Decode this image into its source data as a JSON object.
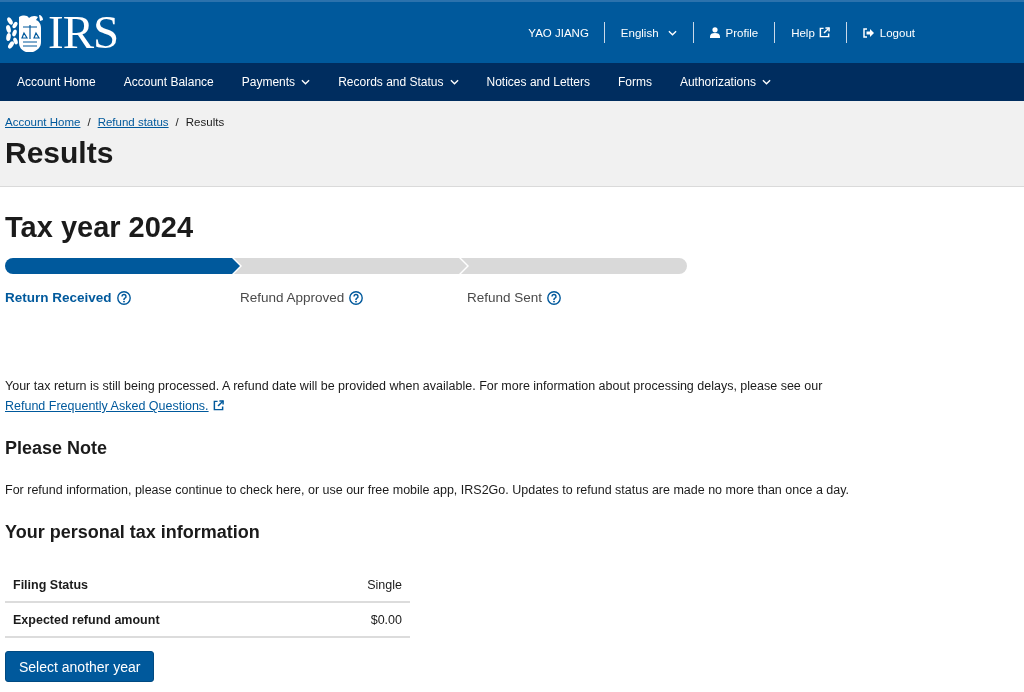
{
  "header": {
    "logo_text": "IRS",
    "user_name": "YAO JIANG",
    "links": [
      {
        "kind": "language",
        "label": "English"
      },
      {
        "kind": "profile",
        "label": "Profile"
      },
      {
        "kind": "help",
        "label": "Help"
      },
      {
        "kind": "logout",
        "label": "Logout"
      }
    ]
  },
  "nav": {
    "items": [
      {
        "label": "Account Home",
        "has_menu": false
      },
      {
        "label": "Account Balance",
        "has_menu": false
      },
      {
        "label": "Payments",
        "has_menu": true
      },
      {
        "label": "Records and Status",
        "has_menu": true
      },
      {
        "label": "Notices and Letters",
        "has_menu": false
      },
      {
        "label": "Forms",
        "has_menu": false
      },
      {
        "label": "Authorizations",
        "has_menu": true
      }
    ]
  },
  "breadcrumb": {
    "separator": "/",
    "items": [
      {
        "kind": "link",
        "label": "Account Home"
      },
      {
        "kind": "link",
        "label": "Refund status"
      },
      {
        "kind": "current",
        "label": "Results"
      }
    ]
  },
  "page_title": "Results",
  "tax_year_title": "Tax year 2024",
  "steps": [
    {
      "label": "Return Received",
      "completed": true
    },
    {
      "label": "Refund Approved",
      "completed": false
    },
    {
      "label": "Refund Sent",
      "completed": false
    }
  ],
  "message": {
    "text": "Your tax return is still being processed. A refund date will be provided when available. For more information about processing delays, please see our",
    "link": "Refund Frequently Asked Questions."
  },
  "note": {
    "heading": "Please Note",
    "text": "For refund information, please continue to check here, or use our free mobile app, IRS2Go. Updates to refund status are made no more than once a day."
  },
  "personal_info": {
    "heading": "Your personal tax information",
    "rows": [
      {
        "label": "Filing Status",
        "value": "Single"
      },
      {
        "label": "Expected refund amount",
        "value": "$0.00"
      }
    ]
  },
  "button": "Select another year"
}
